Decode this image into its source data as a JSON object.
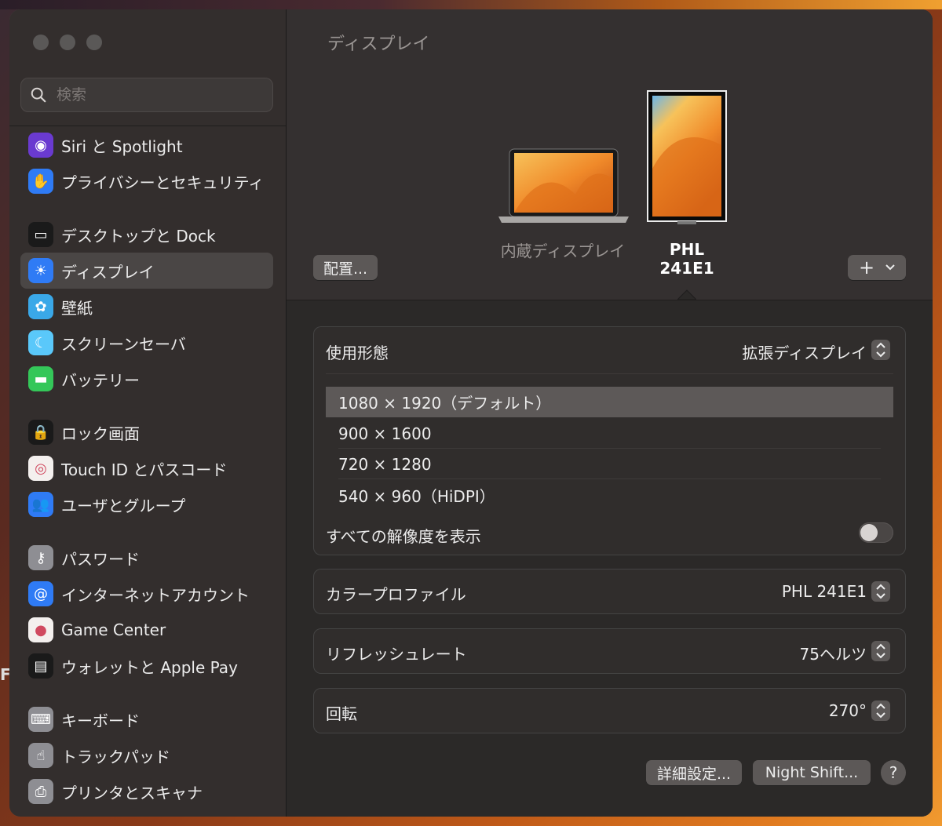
{
  "desktop": {
    "edge_letter": "F"
  },
  "sidebar": {
    "search_placeholder": "検索",
    "groups": [
      [
        {
          "label": "Siri と Spotlight",
          "icon": "siri-icon",
          "color": "#6a3ad0"
        },
        {
          "label": "プライバシーとセキュリティ",
          "icon": "hand-icon",
          "color": "#2f7bf5"
        }
      ],
      [
        {
          "label": "デスクトップと Dock",
          "icon": "dock-icon",
          "color": "#1a1a1a"
        },
        {
          "label": "ディスプレイ",
          "icon": "sun-icon",
          "color": "#2f7bf5",
          "selected": true
        },
        {
          "label": "壁紙",
          "icon": "flower-icon",
          "color": "#3aa8e8"
        },
        {
          "label": "スクリーンセーバ",
          "icon": "screensaver-icon",
          "color": "#5ac8fa"
        },
        {
          "label": "バッテリー",
          "icon": "battery-icon",
          "color": "#34c759"
        }
      ],
      [
        {
          "label": "ロック画面",
          "icon": "lock-icon",
          "color": "#1a1a1a"
        },
        {
          "label": "Touch ID とパスコード",
          "icon": "fingerprint-icon",
          "color": "#f4f0ee"
        },
        {
          "label": "ユーザとグループ",
          "icon": "users-icon",
          "color": "#2f7bf5"
        }
      ],
      [
        {
          "label": "パスワード",
          "icon": "key-icon",
          "color": "#8e8e93"
        },
        {
          "label": "インターネットアカウント",
          "icon": "at-icon",
          "color": "#2f7bf5"
        },
        {
          "label": "Game Center",
          "icon": "gamecenter-icon",
          "color": "#f4f0ee"
        },
        {
          "label": "ウォレットと Apple Pay",
          "icon": "wallet-icon",
          "color": "#1a1a1a"
        }
      ],
      [
        {
          "label": "キーボード",
          "icon": "keyboard-icon",
          "color": "#8e8e93"
        },
        {
          "label": "トラックパッド",
          "icon": "trackpad-icon",
          "color": "#8e8e93"
        },
        {
          "label": "プリンタとスキャナ",
          "icon": "printer-icon",
          "color": "#8e8e93"
        }
      ]
    ]
  },
  "main": {
    "title": "ディスプレイ",
    "arrange_button": "配置...",
    "displays": [
      {
        "name": "内蔵ディスプレイ",
        "selected": false
      },
      {
        "name_line1": "PHL",
        "name_line2": "241E1",
        "selected": true
      }
    ],
    "add_button": "+",
    "usage": {
      "label": "使用形態",
      "value": "拡張ディスプレイ"
    },
    "resolutions": [
      {
        "label": "1080 × 1920（デフォルト）",
        "selected": true
      },
      {
        "label": "900 × 1600",
        "selected": false
      },
      {
        "label": "720 × 1280",
        "selected": false
      },
      {
        "label": "540 × 960（HiDPI）",
        "selected": false
      }
    ],
    "show_all": {
      "label": "すべての解像度を表示",
      "on": false
    },
    "color_profile": {
      "label": "カラープロファイル",
      "value": "PHL 241E1"
    },
    "refresh_rate": {
      "label": "リフレッシュレート",
      "value": "75ヘルツ"
    },
    "rotation": {
      "label": "回転",
      "value": "270°"
    },
    "advanced_button": "詳細設定...",
    "night_shift_button": "Night Shift...",
    "help_button": "?"
  }
}
